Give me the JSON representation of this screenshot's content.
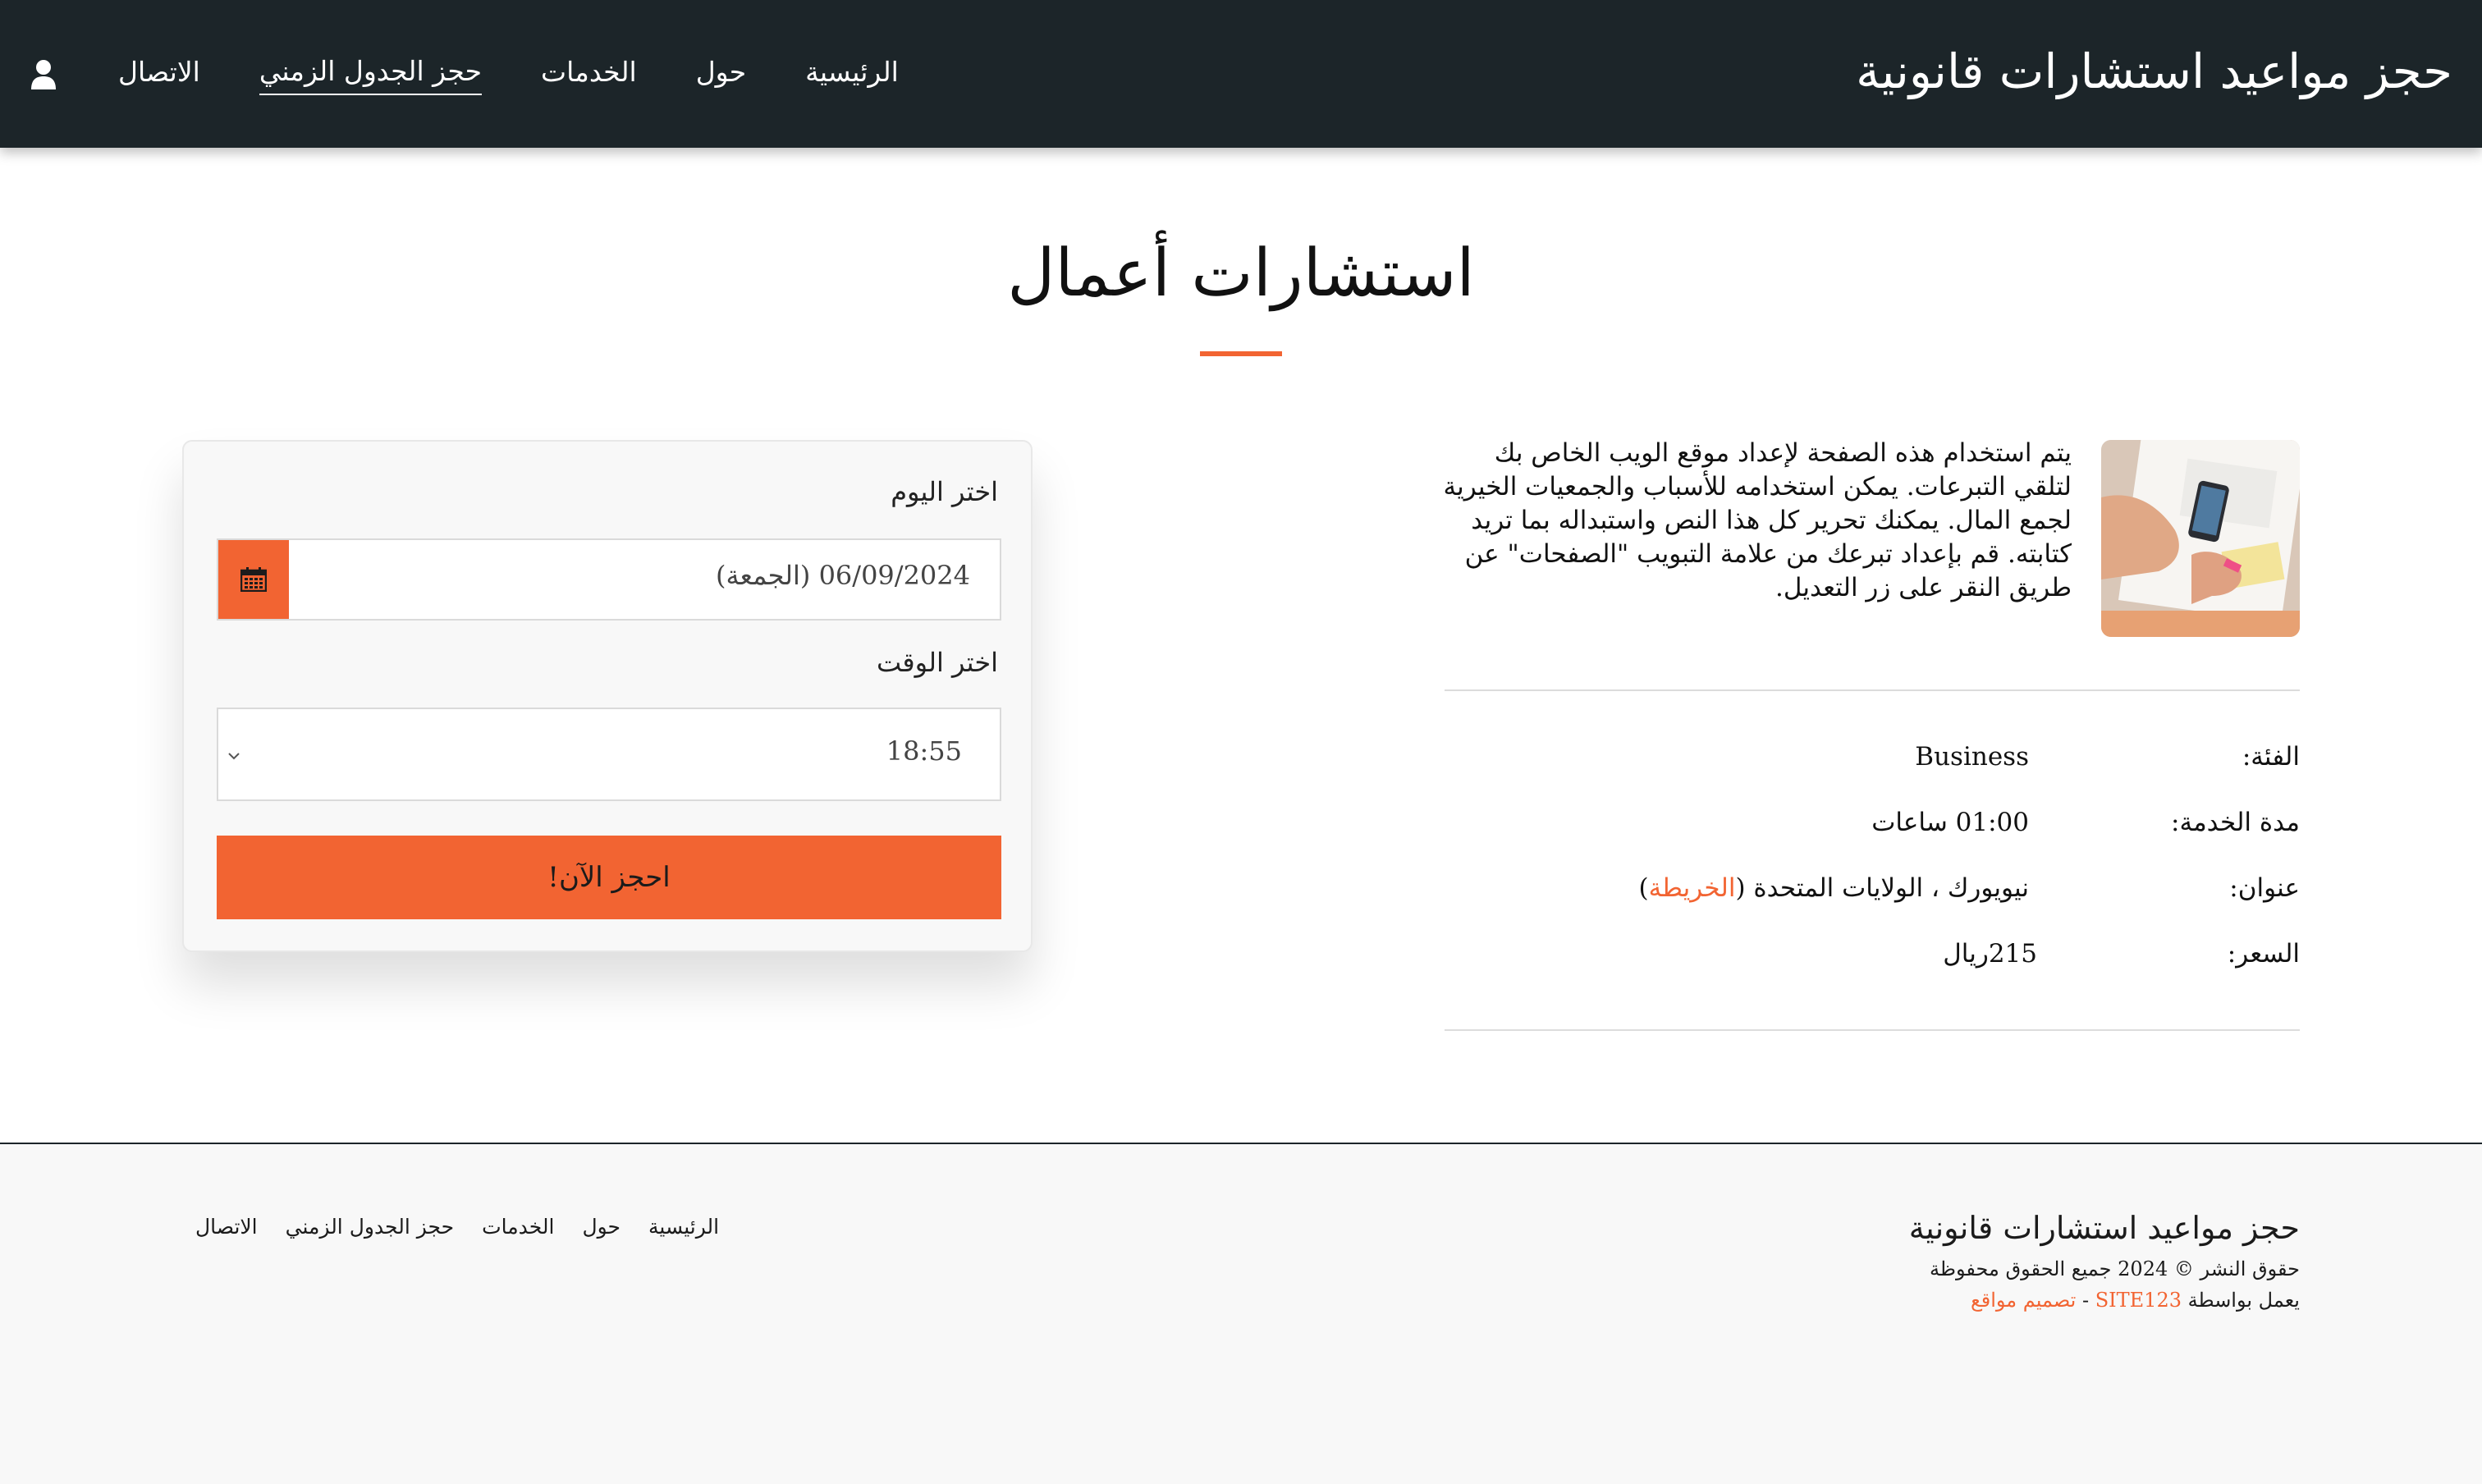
{
  "header": {
    "brand": "حجز مواعيد استشارات قانونية",
    "nav": [
      {
        "label": "الاتصال"
      },
      {
        "label": "حجز الجدول الزمني"
      },
      {
        "label": "الخدمات"
      },
      {
        "label": "حول"
      },
      {
        "label": "الرئيسية"
      }
    ],
    "user_icon": "user-icon"
  },
  "page": {
    "title": "استشارات أعمال"
  },
  "booking": {
    "day_label": "اختر اليوم",
    "date_value": "06/09/2024 (الجمعة)",
    "calendar_icon": "calendar-icon",
    "time_label": "اختر الوقت",
    "time_value": "18:55",
    "book_button": "احجز الآن!"
  },
  "service": {
    "description": "يتم استخدام هذه الصفحة لإعداد موقع الويب الخاص بك لتلقي التبرعات. يمكن استخدامه للأسباب والجمعيات الخيرية لجمع المال. يمكنك تحرير كل هذا النص واستبداله بما تريد كتابته. قم بإعداد تبرعك من علامة التبويب \"الصفحات\" عن طريق النقر على زر التعديل.",
    "details": {
      "category_label": "الفئة:",
      "category_value": "Business",
      "duration_label": "مدة الخدمة:",
      "duration_value": "01:00 ساعات",
      "address_label": "عنوان:",
      "address_value": "نيويورك ، الولايات المتحدة (",
      "map_link": "الخريطة",
      "address_close": ")",
      "price_label": "السعر:",
      "price_value": "215ريال"
    }
  },
  "footer": {
    "brand": "حجز مواعيد استشارات قانونية",
    "copyright": "حقوق النشر © 2024 جميع الحقوق محفوظة",
    "powered_prefix": "يعمل بواسطة",
    "powered_link": "SITE123",
    "powered_sep": " - ",
    "design_link": "تصميم مواقع",
    "nav": [
      {
        "label": "الاتصال"
      },
      {
        "label": "حجز الجدول الزمني"
      },
      {
        "label": "الخدمات"
      },
      {
        "label": "حول"
      },
      {
        "label": "الرئيسية"
      }
    ]
  },
  "colors": {
    "accent": "#f26432",
    "header_bg": "#1c2529",
    "footer_bg": "#f8f8f8"
  }
}
